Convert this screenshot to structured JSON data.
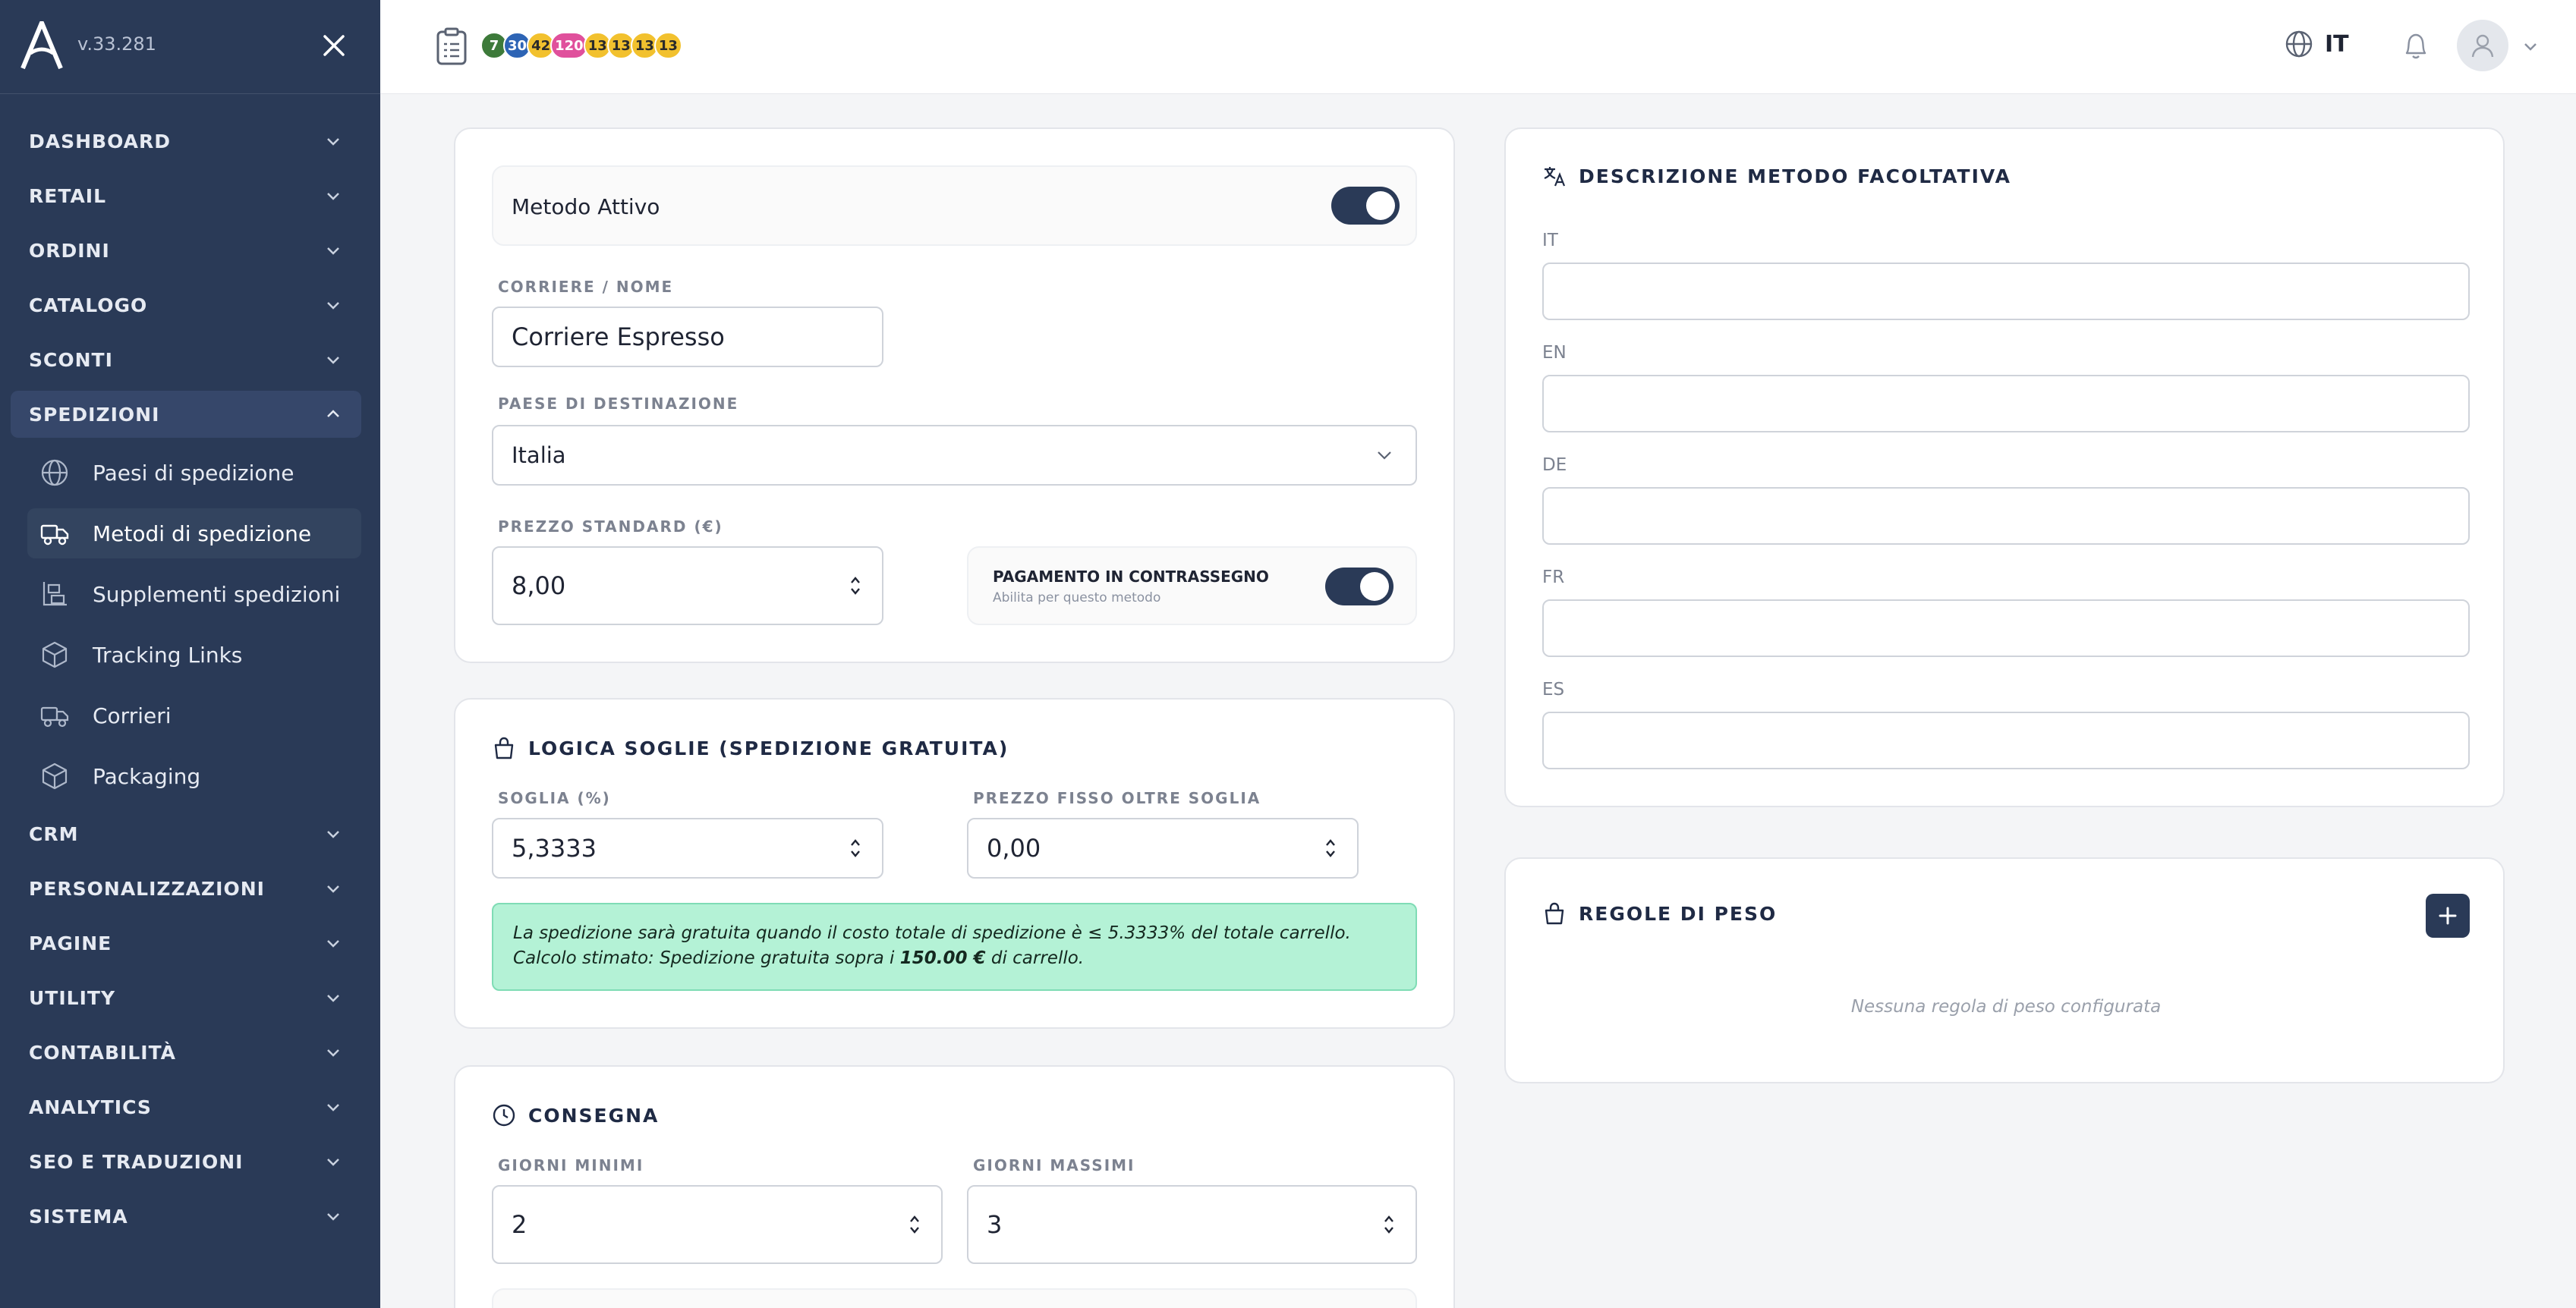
{
  "sidebar": {
    "version": "v.33.281",
    "menu": [
      {
        "label": "DASHBOARD"
      },
      {
        "label": "RETAIL"
      },
      {
        "label": "ORDINI"
      },
      {
        "label": "CATALOGO"
      },
      {
        "label": "SCONTI"
      },
      {
        "label": "SPEDIZIONI"
      },
      {
        "label": "CRM"
      },
      {
        "label": "PERSONALIZZAZIONI"
      },
      {
        "label": "PAGINE"
      },
      {
        "label": "UTILITY"
      },
      {
        "label": "CONTABILITÀ"
      },
      {
        "label": "ANALYTICS"
      },
      {
        "label": "SEO E TRADUZIONI"
      },
      {
        "label": "SISTEMA"
      }
    ],
    "submenu": [
      {
        "label": "Paesi di spedizione",
        "icon": "globe-icon"
      },
      {
        "label": "Metodi di spedizione",
        "icon": "truck-icon"
      },
      {
        "label": "Supplementi spedizioni",
        "icon": "boxes-icon"
      },
      {
        "label": "Tracking Links",
        "icon": "package-icon"
      },
      {
        "label": "Corrieri",
        "icon": "truck-icon"
      },
      {
        "label": "Packaging",
        "icon": "package-icon"
      }
    ]
  },
  "topbar": {
    "badges": [
      {
        "value": "7",
        "color": "green"
      },
      {
        "value": "30",
        "color": "blue"
      },
      {
        "value": "42",
        "color": "yellow"
      },
      {
        "value": "120",
        "color": "pink"
      },
      {
        "value": "13",
        "color": "yellow"
      },
      {
        "value": "13",
        "color": "yellow"
      },
      {
        "value": "13",
        "color": "yellow"
      },
      {
        "value": "13",
        "color": "yellow"
      }
    ],
    "language": "IT"
  },
  "main": {
    "active_label": "Metodo Attivo",
    "carrier_label": "CORRIERE / NOME",
    "carrier_value": "Corriere Espresso",
    "country_label": "PAESE DI DESTINAZIONE",
    "country_value": "Italia",
    "price_label": "PREZZO STANDARD (€)",
    "price_value": "8,00",
    "cod_title": "PAGAMENTO IN CONTRASSEGNO",
    "cod_sub": "Abilita per questo metodo",
    "threshold_title": "LOGICA SOGLIE (SPEDIZIONE GRATUITA)",
    "threshold_label": "SOGLIA (%)",
    "threshold_value": "5,3333",
    "fixed_label": "PREZZO FISSO OLTRE SOGLIA",
    "fixed_value": "0,00",
    "info_line1": "La spedizione sarà gratuita quando il costo totale di spedizione è ≤ 5.3333% del totale carrello.",
    "info_line2_pre": "Calcolo stimato: Spedizione gratuita sopra i ",
    "info_line2_bold": "150.00 €",
    "info_line2_post": " di carrello.",
    "delivery_title": "CONSEGNA",
    "min_days_label": "GIORNI MINIMI",
    "min_days_value": "2",
    "max_days_label": "GIORNI MASSIMI",
    "max_days_value": "3"
  },
  "description": {
    "title": "DESCRIZIONE METODO FACOLTATIVA",
    "languages": [
      "IT",
      "EN",
      "DE",
      "FR",
      "ES"
    ]
  },
  "weight": {
    "title": "REGOLE DI PESO",
    "empty": "Nessuna regola di peso configurata"
  },
  "colors": {
    "sidebar": "#2a3a57",
    "accent": "#2a3a57",
    "info_bg": "#b4f2d6"
  }
}
